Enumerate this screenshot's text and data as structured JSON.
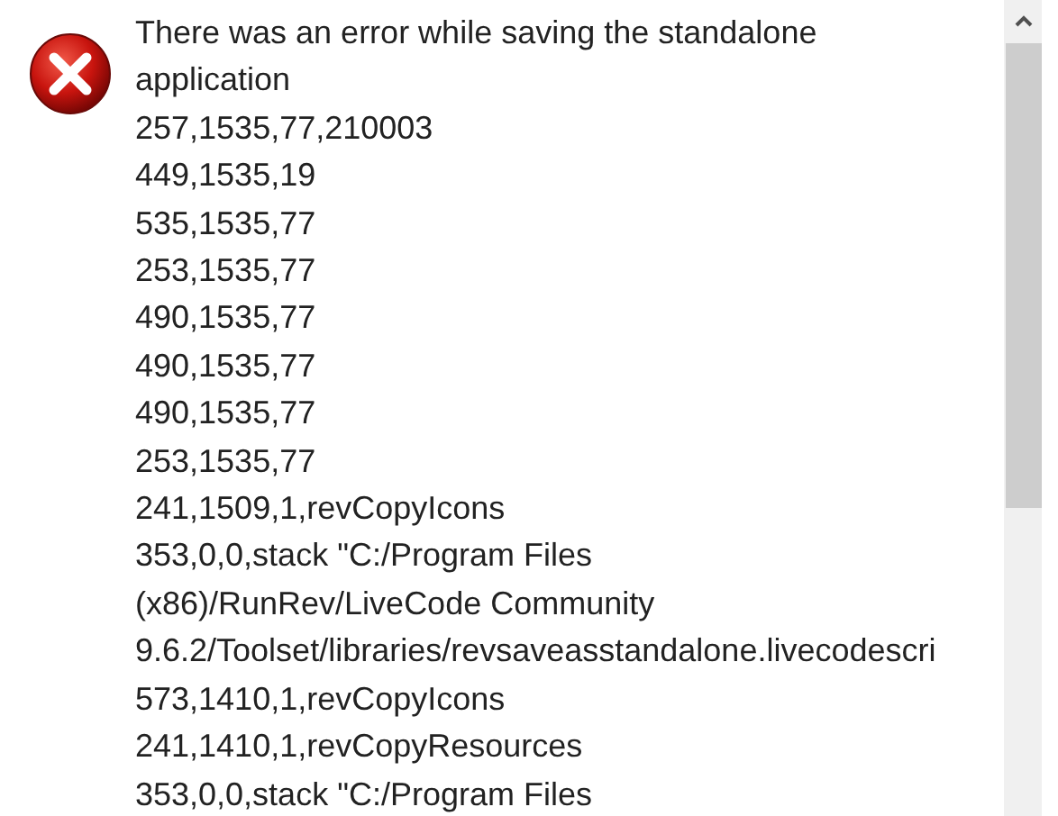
{
  "message": {
    "lines": [
      "There was an error while saving the standalone",
      "application",
      "257,1535,77,210003",
      "449,1535,19",
      "535,1535,77",
      "253,1535,77",
      "490,1535,77",
      "490,1535,77",
      "490,1535,77",
      "253,1535,77",
      "241,1509,1,revCopyIcons",
      "353,0,0,stack \"C:/Program Files",
      "(x86)/RunRev/LiveCode Community",
      "9.6.2/Toolset/libraries/revsaveasstandalone.livecodescri",
      "573,1410,1,revCopyIcons",
      "241,1410,1,revCopyResources",
      "353,0,0,stack \"C:/Program Files"
    ]
  }
}
